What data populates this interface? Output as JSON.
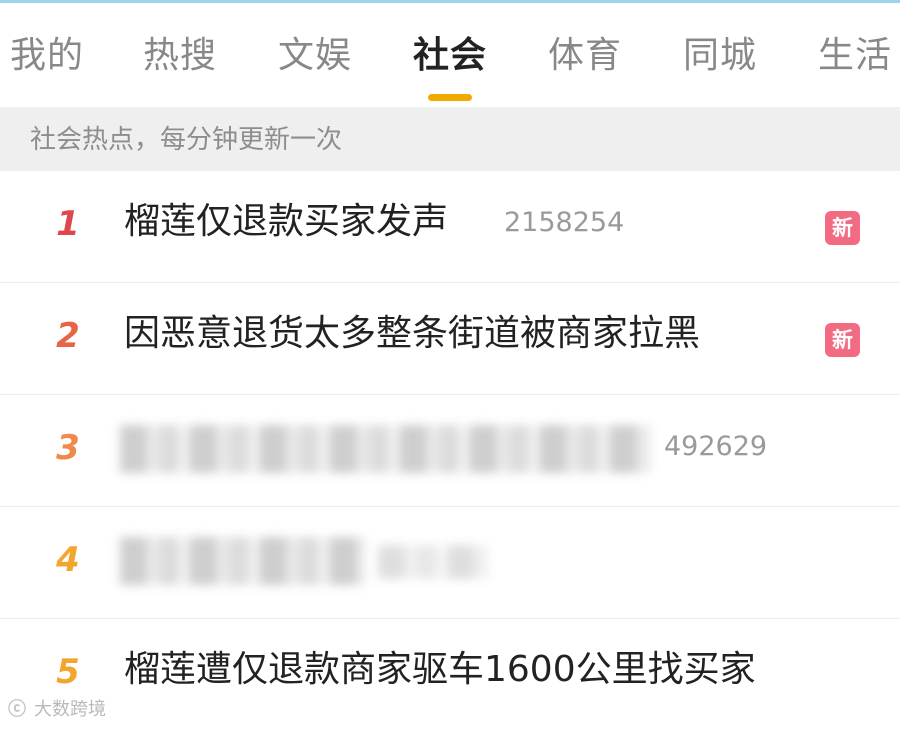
{
  "tabs": [
    {
      "label": "我的"
    },
    {
      "label": "热搜"
    },
    {
      "label": "文娱"
    },
    {
      "label": "社会"
    },
    {
      "label": "体育"
    },
    {
      "label": "同城"
    },
    {
      "label": "生活"
    }
  ],
  "active_tab": "社会",
  "notice": "社会热点，每分钟更新一次",
  "list": [
    {
      "rank": "1",
      "title": "榴莲仅退款买家发声",
      "count": "2158254",
      "badge": "新"
    },
    {
      "rank": "2",
      "title": "因恶意退货太多整条街道被商家拉黑",
      "badge": "新"
    },
    {
      "rank": "3",
      "count": "492629"
    },
    {
      "rank": "4"
    },
    {
      "rank": "5",
      "title": "榴莲遭仅退款商家驱车1600公里找买家"
    }
  ],
  "watermark": {
    "text": "大数跨境",
    "icon": "watermark-logo-icon"
  },
  "colors": {
    "accent_underline": "#f2a900",
    "rank_1": "#e0474c",
    "rank_2": "#e86447",
    "rank_3": "#f08a4b",
    "rank_4": "#f2a62f",
    "rank_5": "#f2a62f",
    "new_badge": "#f26b82"
  }
}
